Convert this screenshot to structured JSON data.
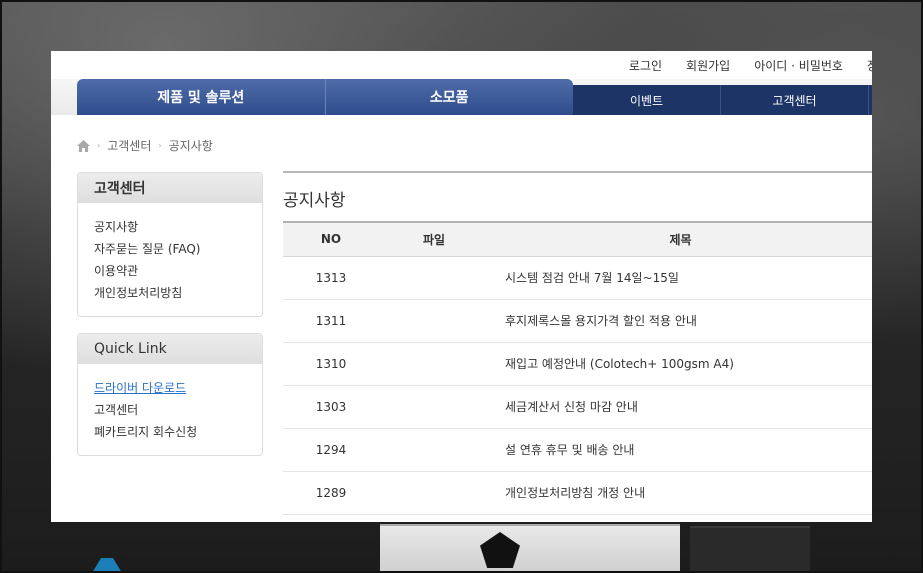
{
  "header": {
    "utility_links": [
      "로그인",
      "회원가입",
      "아이디 · 비밀번호",
      "장"
    ],
    "main_nav": [
      "제품 및 솔루션",
      "소모품"
    ],
    "sub_nav": [
      "이벤트",
      "고객센터"
    ]
  },
  "breadcrumb": [
    "고객센터",
    "공지사항"
  ],
  "sidebar": {
    "support_title": "고객센터",
    "support_items": [
      "공지사항",
      "자주묻는 질문 (FAQ)",
      "이용약관",
      "개인정보처리방침"
    ],
    "quick_title": "Quick Link",
    "quick_items": [
      "드라이버 다운로드",
      "고객센터",
      "폐카트리지 회수신청"
    ]
  },
  "notice": {
    "title": "공지사항",
    "columns": [
      "NO",
      "파일",
      "제목"
    ],
    "rows": [
      {
        "no": "1313",
        "file": "",
        "title": "시스템 점검 안내 7월 14일~15일"
      },
      {
        "no": "1311",
        "file": "",
        "title": "후지제록스몰 용지가격 할인 적용 안내"
      },
      {
        "no": "1310",
        "file": "",
        "title": "재입고 예정안내 (Colotech+ 100gsm  A4)"
      },
      {
        "no": "1303",
        "file": "",
        "title": "세금계산서 신청 마감 안내"
      },
      {
        "no": "1294",
        "file": "",
        "title": "설 연휴 휴무 및 배송 안내"
      },
      {
        "no": "1289",
        "file": "",
        "title": "개인정보처리방침 개정 안내"
      }
    ]
  },
  "colors": {
    "nav_blue": "#2f4c8c",
    "nav_dark": "#1d3466",
    "link_blue": "#2a72c2"
  }
}
